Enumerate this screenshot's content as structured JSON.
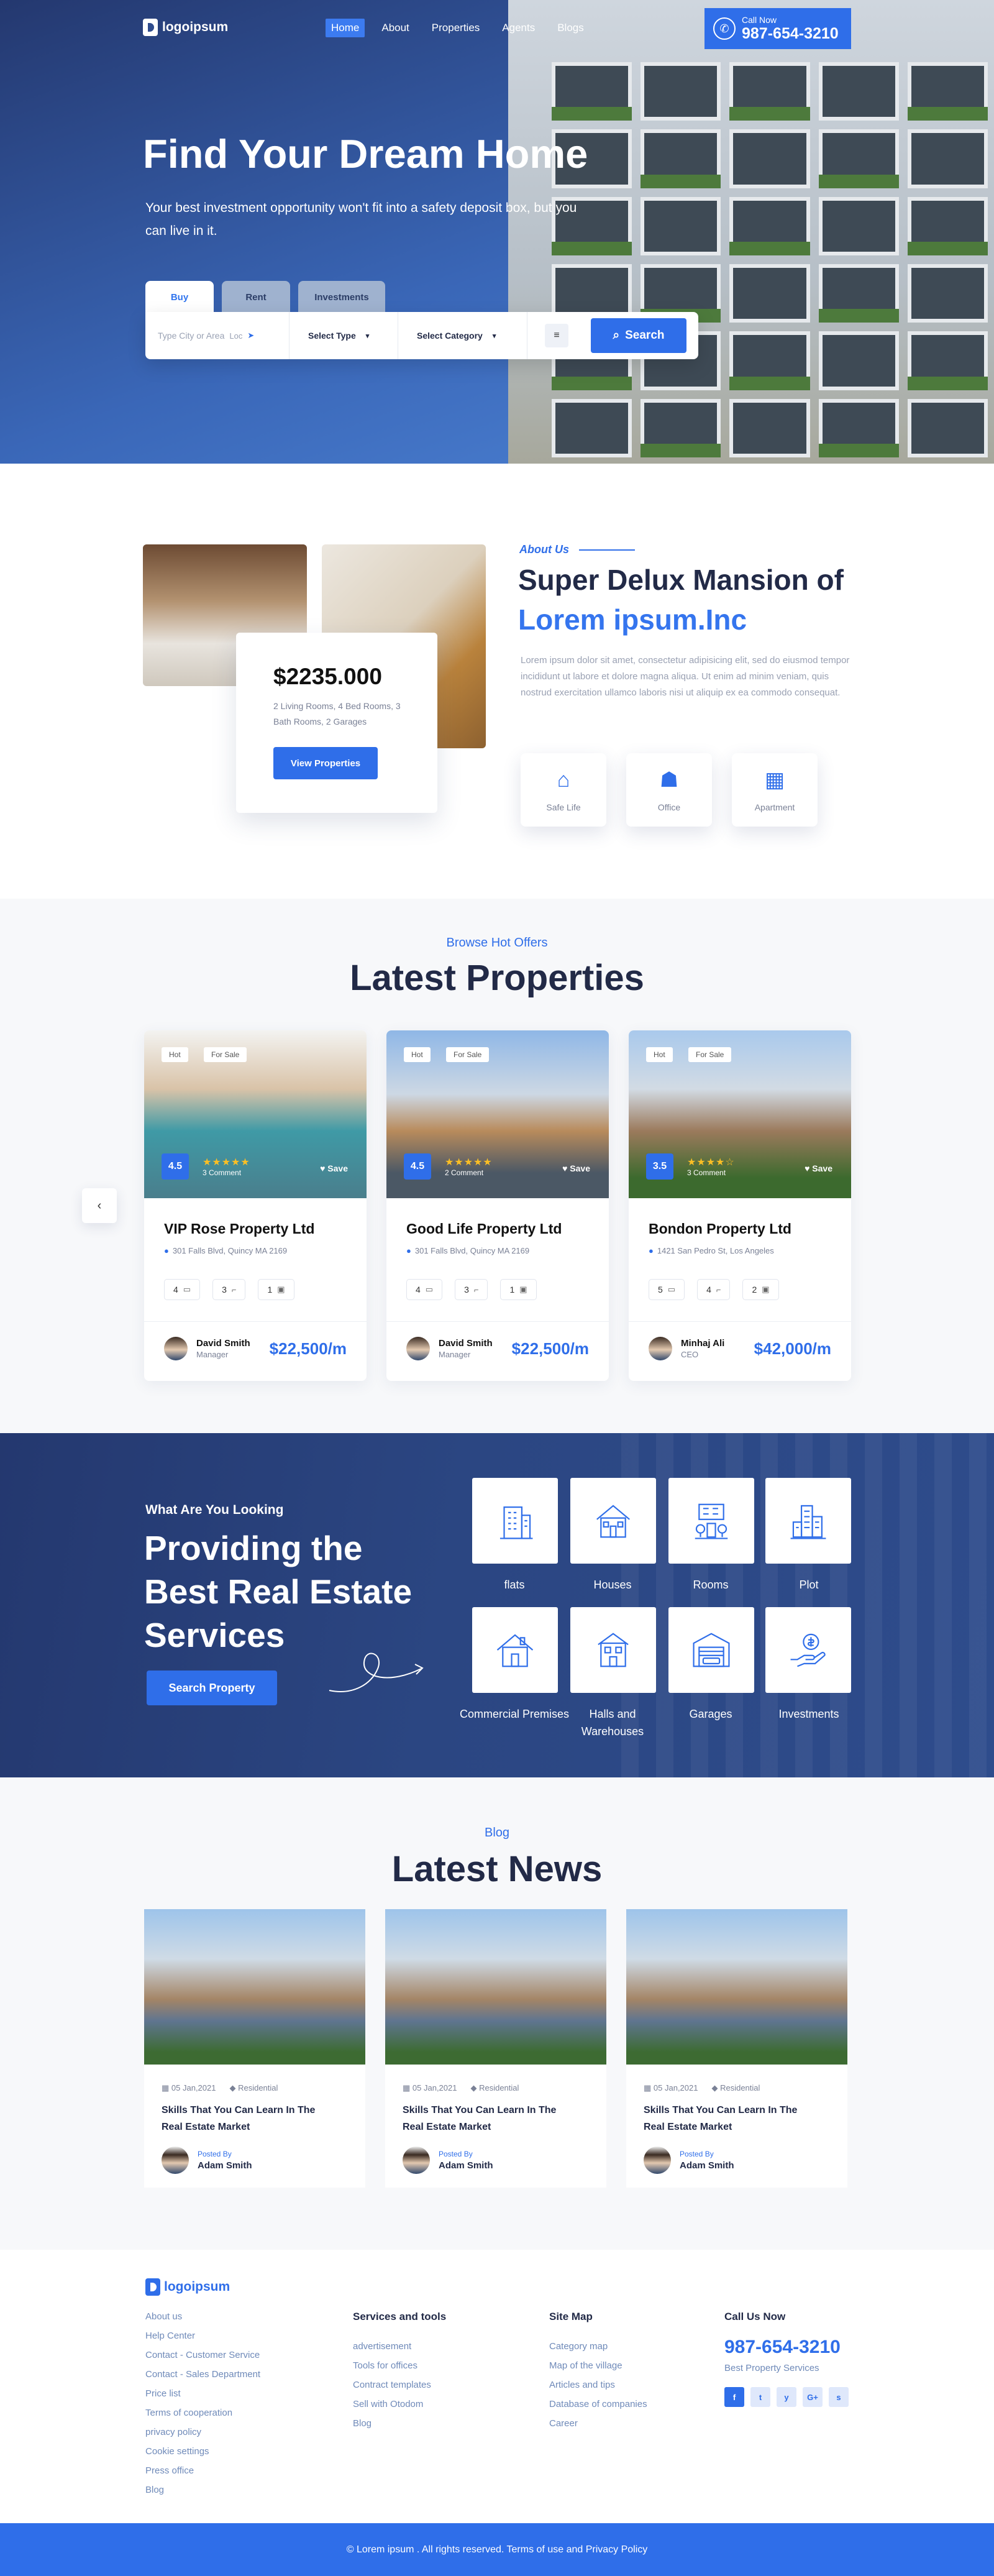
{
  "header": {
    "logo": "logoipsum",
    "nav": [
      "Home",
      "About",
      "Properties",
      "Agents",
      "Blogs"
    ],
    "call_label": "Call Now",
    "call_number": "987-654-3210"
  },
  "hero": {
    "title": "Find Your Dream Home",
    "subtitle": "Your best investment opportunity won't fit into a safety deposit box, but you can live in it.",
    "tabs": [
      "Buy",
      "Rent",
      "Investments"
    ],
    "search": {
      "placeholder": "Type City or Area",
      "location_btn": "Loc",
      "type_label": "Select Type",
      "category_label": "Select Category",
      "button": "Search"
    }
  },
  "about": {
    "price": "$2235.000",
    "details": "2 Living Rooms, 4 Bed Rooms, 3 Bath Rooms, 2 Garages",
    "button": "View Properties",
    "tag": "About Us",
    "title_1": "Super Delux Mansion of",
    "title_2": "Lorem ipsum.Inc",
    "text": "Lorem ipsum dolor sit amet, consectetur adipisicing elit, sed do eiusmod tempor incididunt ut labore et dolore magna aliqua. Ut enim ad minim veniam, quis nostrud exercitation ullamco laboris nisi ut aliquip ex ea commodo consequat.",
    "features": [
      "Safe Life",
      "Office",
      "Apartment"
    ]
  },
  "properties": {
    "tag": "Browse Hot Offers",
    "title": "Latest Properties",
    "prev": "‹",
    "items": [
      {
        "badge1": "Hot",
        "badge2": "For Sale",
        "rating": "4.5",
        "comments": "3 Comment",
        "save": "Save",
        "title": "VIP Rose Property Ltd",
        "address": "301 Falls Blvd, Quincy MA 2169",
        "beds": "4",
        "baths": "3",
        "garage": "1",
        "agent": "David Smith",
        "role": "Manager",
        "price": "$22,500/m"
      },
      {
        "badge1": "Hot",
        "badge2": "For Sale",
        "rating": "4.5",
        "comments": "2 Comment",
        "save": "Save",
        "title": "Good Life Property Ltd",
        "address": "301 Falls Blvd, Quincy MA 2169",
        "beds": "4",
        "baths": "3",
        "garage": "1",
        "agent": "David Smith",
        "role": "Manager",
        "price": "$22,500/m"
      },
      {
        "badge1": "Hot",
        "badge2": "For Sale",
        "rating": "3.5",
        "comments": "3 Comment",
        "save": "Save",
        "title": "Bondon Property Ltd",
        "address": "1421 San Pedro St, Los Angeles",
        "beds": "5",
        "baths": "4",
        "garage": "2",
        "agent": "Minhaj Ali",
        "role": "CEO",
        "price": "$42,000/m"
      }
    ]
  },
  "services": {
    "tag": "What Are You Looking",
    "title": "Providing the Best Real Estate Services",
    "button": "Search Property",
    "items": [
      "flats",
      "Houses",
      "Rooms",
      "Plot",
      "Commercial Premises",
      "Halls and Warehouses",
      "Garages",
      "Investments"
    ]
  },
  "blog": {
    "tag": "Blog",
    "title": "Latest News",
    "posts": [
      {
        "date": "05 Jan,2021",
        "category": "Residential",
        "title": "Skills That You Can Learn In The Real Estate Market",
        "posted": "Posted By",
        "author": "Adam Smith"
      },
      {
        "date": "05 Jan,2021",
        "category": "Residential",
        "title": "Skills That You Can Learn In The Real Estate Market",
        "posted": "Posted By",
        "author": "Adam Smith"
      },
      {
        "date": "05 Jan,2021",
        "category": "Residential",
        "title": "Skills That You Can Learn In The Real Estate Market",
        "posted": "Posted By",
        "author": "Adam Smith"
      }
    ]
  },
  "footer": {
    "logo": "logoipsum",
    "col1": [
      "About us",
      "Help Center",
      "Contact - Customer Service",
      "Contact - Sales Department",
      "Price list",
      "Terms of cooperation",
      "privacy policy",
      "Cookie settings",
      "Press office",
      "Blog"
    ],
    "col2_title": "Services and tools",
    "col2": [
      "advertisement",
      "Tools for offices",
      "Contract templates",
      "Sell with Otodom",
      "Blog"
    ],
    "col3_title": "Site Map",
    "col3": [
      "Category map",
      "Map of the village",
      "Articles and tips",
      "Database of companies",
      "Career"
    ],
    "col4_title": "Call Us Now",
    "phone": "987-654-3210",
    "phone_sub": "Best Property Services",
    "socials": [
      "f",
      "t",
      "y",
      "G+",
      "s"
    ],
    "copyright": "© Lorem ipsum . All rights reserved. Terms of use and Privacy Policy"
  },
  "colors": {
    "primary": "#2f6ee9",
    "navy": "#24386f",
    "heading": "#222a47"
  }
}
